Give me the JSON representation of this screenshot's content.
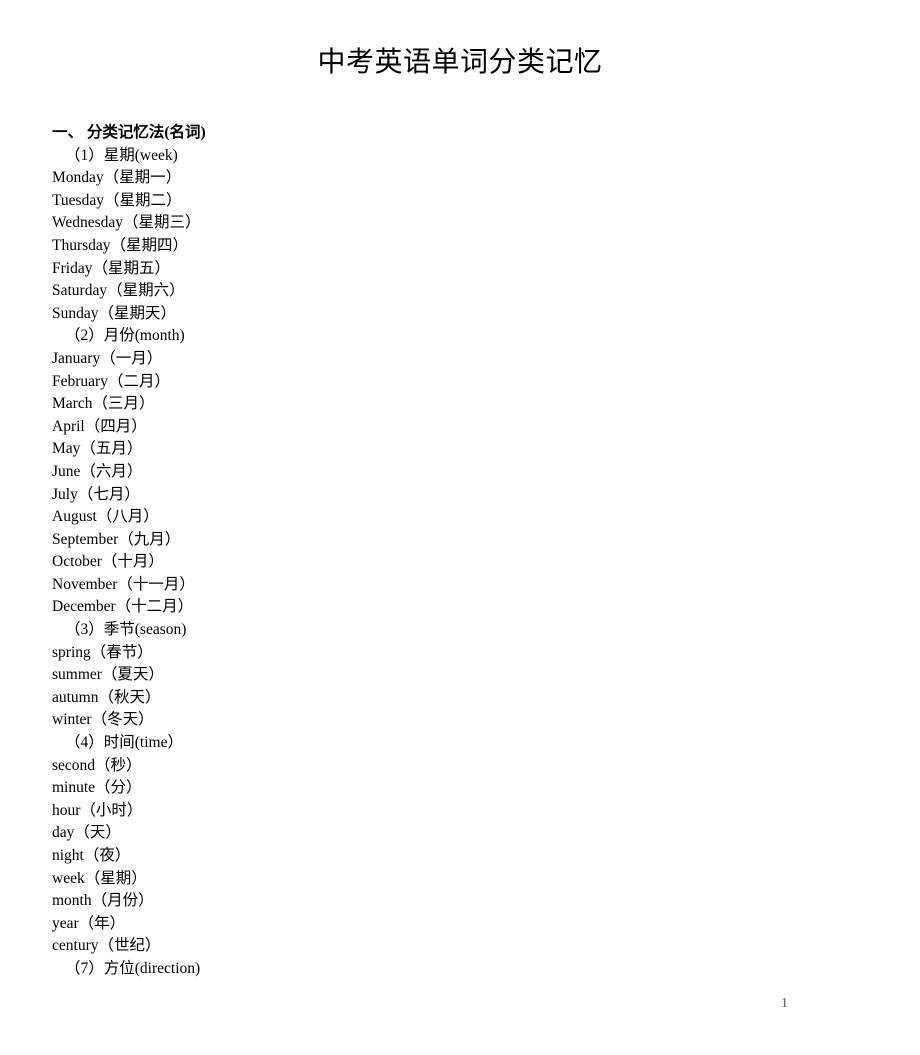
{
  "document": {
    "title": "中考英语单词分类记忆",
    "page_number": "1"
  },
  "content": {
    "section_heading": "一、 分类记忆法(名词)",
    "groups": [
      {
        "label": "（1）星期(week)",
        "entries": [
          "Monday（星期一）",
          "Tuesday（星期二）",
          "Wednesday（星期三）",
          "Thursday（星期四）",
          "Friday（星期五）",
          "Saturday（星期六）",
          "Sunday（星期天）"
        ]
      },
      {
        "label": "（2）月份(month)",
        "entries": [
          "January（一月）",
          "February（二月）",
          "March（三月）",
          "April（四月）",
          "May（五月）",
          "June（六月）",
          "July（七月）",
          "August（八月）",
          "September（九月）",
          "October（十月）",
          "November（十一月）",
          "December（十二月）"
        ]
      },
      {
        "label": "（3）季节(season)",
        "entries": [
          "spring（春节）",
          "summer（夏天）",
          "autumn（秋天）",
          "winter（冬天）"
        ]
      },
      {
        "label": "（4）时间(time）",
        "entries": [
          "second（秒）",
          "minute（分）",
          "hour（小时）",
          "day（天）",
          "night（夜）",
          "week（星期）",
          "month（月份）",
          "year（年）",
          "century（世纪）"
        ]
      },
      {
        "label": "（7）方位(direction)",
        "entries": []
      }
    ]
  }
}
